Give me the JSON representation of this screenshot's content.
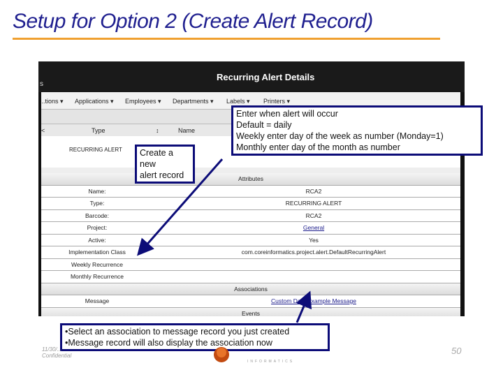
{
  "slide": {
    "title": "Setup for Option 2 (Create Alert Record)",
    "page_number": "50",
    "footer_date": "11/30/...",
    "footer_confidential": "Confidential",
    "logo_text": "INFORMATICS"
  },
  "app": {
    "header_title": "Recurring Alert Details",
    "header_left": "s",
    "nav": [
      "...tions ▾",
      "Applications ▾",
      "Employees ▾",
      "Departments ▾",
      "Labels ▾",
      "Printers ▾"
    ],
    "table_headers": [
      "<",
      "Type",
      "↕",
      "Name"
    ],
    "row_type": "RECURRING ALERT",
    "attributes_header": "Attributes",
    "attributes": [
      {
        "label": "Name:",
        "value": "RCA2"
      },
      {
        "label": "Type:",
        "value": "RECURRING ALERT"
      },
      {
        "label": "Barcode:",
        "value": "RCA2"
      },
      {
        "label": "Project:",
        "value": "General",
        "link": true
      },
      {
        "label": "Active:",
        "value": "Yes"
      },
      {
        "label": "Implementation Class",
        "value": "com.coreinformatics.project.alert.DefaultRecurringAlert"
      },
      {
        "label": "Weekly Recurrence",
        "value": ""
      },
      {
        "label": "Monthly Recurrence",
        "value": ""
      }
    ],
    "associations_header": "Associations",
    "associations": [
      {
        "label": "Message",
        "value": "Custom Data Example Message",
        "link": true
      }
    ],
    "events_header": "Events"
  },
  "callouts": {
    "create": [
      "Create a new",
      "alert record"
    ],
    "recurrence": [
      "Enter when alert will occur",
      "Default = daily",
      "Weekly enter day of the week as number (Monday=1)",
      "Monthly enter day of the month as number"
    ],
    "association": [
      "•Select an association to message record you just created",
      "•Message record will also display the association now"
    ]
  },
  "colors": {
    "callout_border": "#0c0c78",
    "title": "#1f1f8f",
    "rule": "#f0a030"
  }
}
